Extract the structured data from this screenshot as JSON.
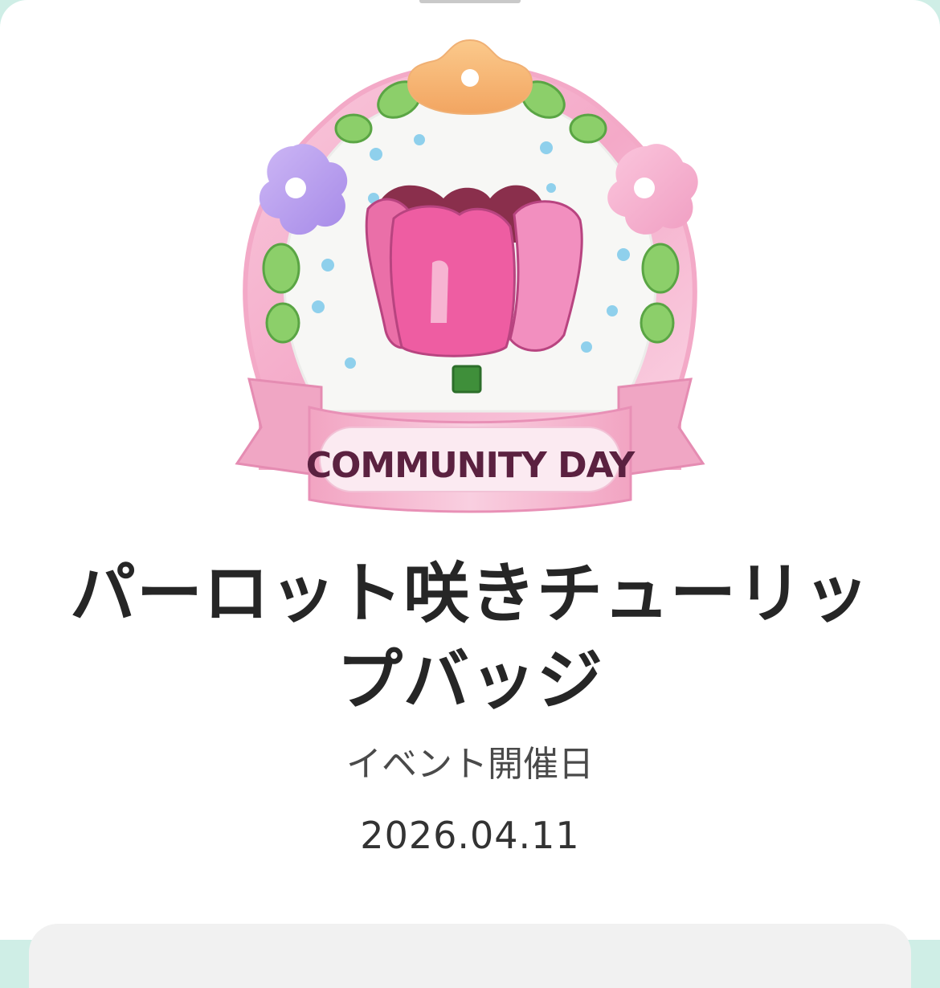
{
  "badge": {
    "ribbon_text": "COMMUNITY DAY",
    "image_description_icon": "tulip-badge-icon"
  },
  "title_lines": [
    "パーロット咲きチューリッ",
    "プバッジ"
  ],
  "event_label": "イベント開催日",
  "event_date": "2026.04.11",
  "colors": {
    "background": "#ffffff",
    "teal_backdrop": "#cfeee6",
    "title": "#262626",
    "ribbon_pink": "#f2b8cf",
    "tulip_pink": "#e85aa0"
  }
}
